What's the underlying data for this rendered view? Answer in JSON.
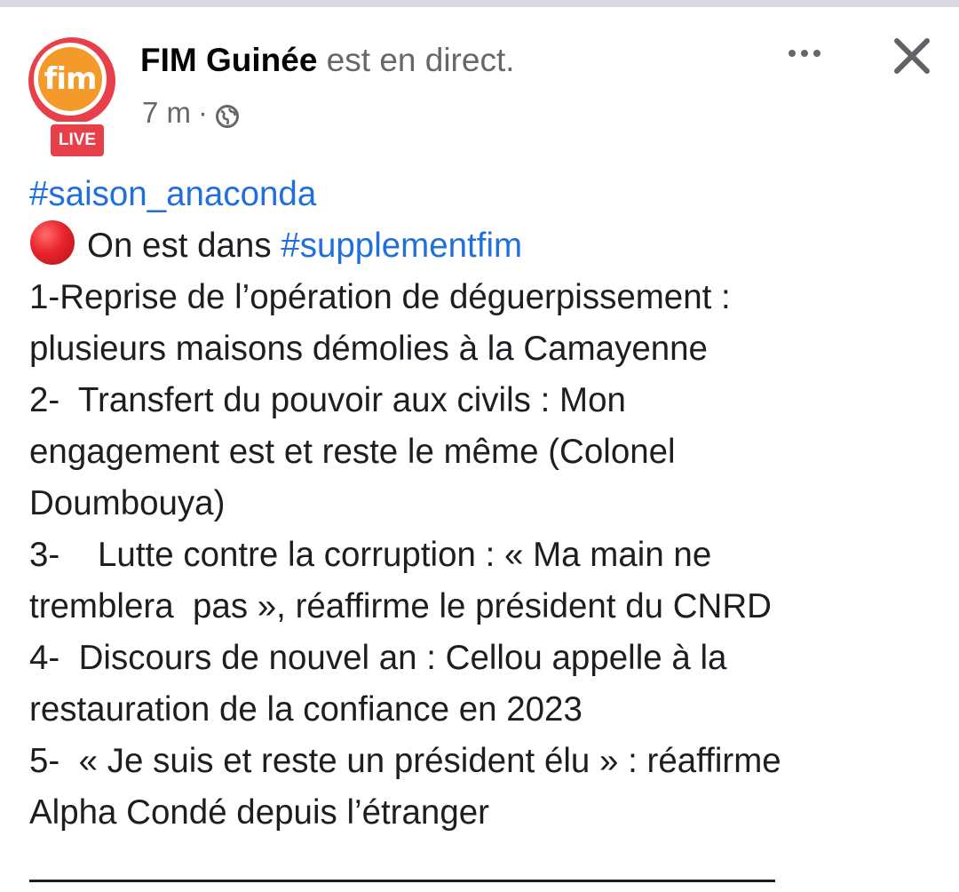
{
  "header": {
    "avatar_logo_text": "fim",
    "live_badge": "LIVE",
    "page_name": "FIM Guinée",
    "status": " est en direct.",
    "time": "7 m",
    "separator": "·",
    "privacy_icon": "globe-icon",
    "more_icon": "more-options-icon",
    "close_icon": "close-icon"
  },
  "post": {
    "hashtag_top": "#saison_anaconda",
    "intro_emoji": "red-circle-icon",
    "intro_text": "On est dans ",
    "intro_hashtag": "#supplementfim",
    "lines": [
      "1-Reprise de l’opération de déguerpissement :",
      "plusieurs maisons démolies à la Camayenne",
      "2-  Transfert du pouvoir aux civils : Mon",
      "engagement est et reste le même (Colonel",
      "Doumbouya)",
      "3-    Lutte contre la corruption : « Ma main ne",
      "tremblera  pas », réaffirme le président du CNRD",
      "4-  Discours de nouvel an : Cellou appelle à la",
      "restauration de la confiance en 2023",
      "5-  « Je suis et reste un président élu » : réaffirme",
      "Alpha Condé depuis l’étranger"
    ]
  },
  "colors": {
    "live_red": "#e8404a",
    "logo_orange": "#f39a2b",
    "hashtag_blue": "#216fdb",
    "secondary_text": "#65676b"
  }
}
